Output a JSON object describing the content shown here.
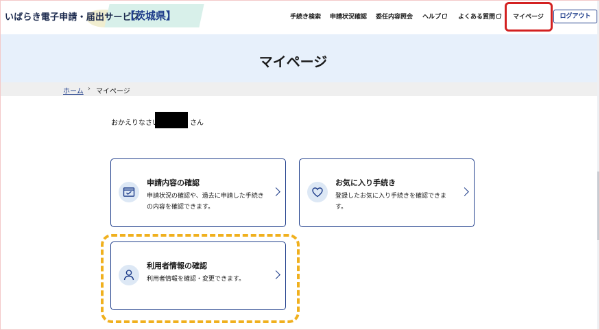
{
  "header": {
    "service_name": "いばらき電子申請・届出サービス",
    "prefecture": "【茨城県】",
    "nav": [
      {
        "label": "手続き検索",
        "external": false
      },
      {
        "label": "申請状況確認",
        "external": false
      },
      {
        "label": "委任内容照会",
        "external": false
      },
      {
        "label": "ヘルプ",
        "external": true
      },
      {
        "label": "よくある質問",
        "external": true
      },
      {
        "label": "マイページ",
        "external": false
      }
    ],
    "logout_label": "ログアウト"
  },
  "page": {
    "title": "マイページ"
  },
  "breadcrumb": {
    "home": "ホーム",
    "separator": "›",
    "current": "マイページ"
  },
  "greeting": {
    "prefix": "おかえりなさい",
    "suffix": "さん"
  },
  "cards": [
    {
      "title": "申請内容の確認",
      "description": "申請状況の確認や、過去に申請した手続きの内容を確認できます。",
      "icon": "calendar-window-icon"
    },
    {
      "title": "お気に入り手続き",
      "description": "登録したお気に入り手続きを確認できます。",
      "icon": "heart-icon"
    },
    {
      "title": "利用者情報の確認",
      "description": "利用者情報を確認・変更できます。",
      "icon": "user-icon"
    }
  ],
  "colors": {
    "brand_navy": "#1d3c8a",
    "title_band": "#e7f0fb",
    "highlight_red": "#d32121",
    "highlight_yellow": "#f0b01e"
  }
}
